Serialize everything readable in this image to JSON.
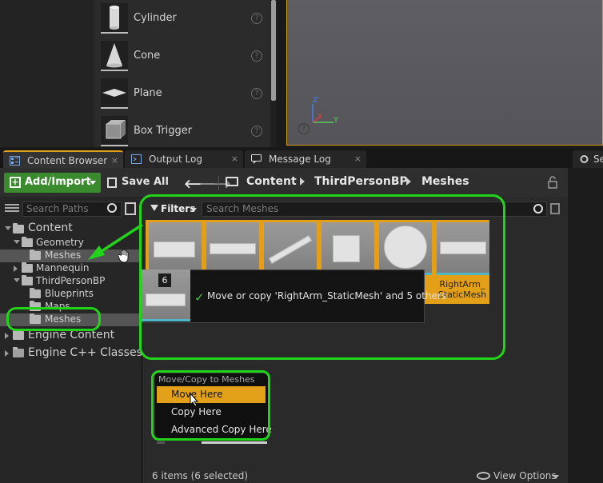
{
  "place_actors": {
    "items": [
      {
        "label": "Cylinder",
        "help": "?"
      },
      {
        "label": "Cone",
        "help": "?"
      },
      {
        "label": "Plane",
        "help": "?"
      },
      {
        "label": "Box Trigger",
        "help": "?"
      }
    ]
  },
  "viewport": {
    "axis_z": "Z",
    "axis_x": "X",
    "axis_y": "Y",
    "help": "?"
  },
  "tabs": [
    {
      "label": "Content Browser",
      "close": "×"
    },
    {
      "label": "Output Log",
      "close": "×"
    },
    {
      "label": "Message Log",
      "close": "×"
    },
    {
      "label": "Se"
    }
  ],
  "toolbar": {
    "add_import_label": "Add/Import",
    "save_all_label": "Save All",
    "back_arrow": "🡐",
    "forward_arrow": "🡒"
  },
  "breadcrumb": [
    "Content",
    "ThirdPersonBP",
    "Meshes"
  ],
  "sources": {
    "search_placeholder": "Search Paths",
    "tree": [
      {
        "label": "Content"
      },
      {
        "label": "Geometry"
      },
      {
        "label": "Meshes"
      },
      {
        "label": "Mannequin"
      },
      {
        "label": "ThirdPersonBP"
      },
      {
        "label": "Blueprints"
      },
      {
        "label": "Maps"
      },
      {
        "label": "Meshes"
      },
      {
        "label": "Engine Content"
      },
      {
        "label": "Engine C++ Classes"
      }
    ]
  },
  "assets": {
    "filters_label": "Filters",
    "search_placeholder": "Search Meshes",
    "visible_tile_label": "RightArm_\nStaticMesh",
    "drag_count": "6",
    "drag_check": "✓",
    "drag_message": "Move or copy 'RightArm_StaticMesh' and 5 others"
  },
  "context_menu": {
    "header": "Move/Copy to Meshes",
    "items": [
      "Move Here",
      "Copy Here",
      "Advanced Copy Here"
    ]
  },
  "status": {
    "items_text": "6 items (6 selected)",
    "view_options_label": "View Options"
  },
  "colors": {
    "accent_orange": "#e39f17",
    "add_import_green": "#3a8a2e",
    "annotation_green": "#21d41a",
    "check_green": "#49c24a"
  }
}
